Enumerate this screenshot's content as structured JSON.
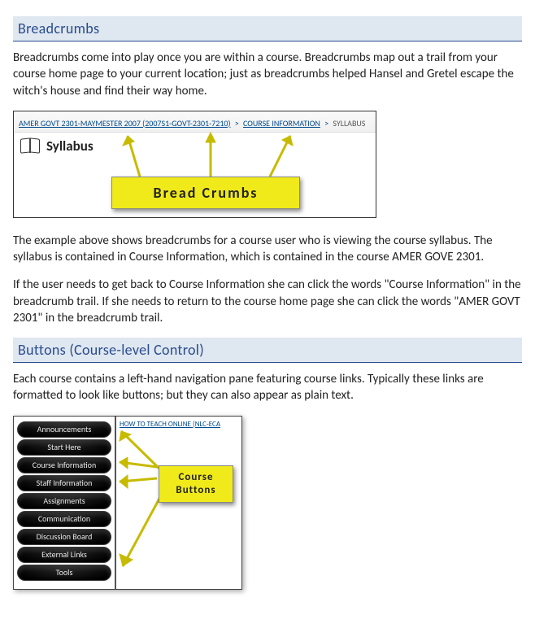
{
  "sections": {
    "breadcrumbs": {
      "heading": "Breadcrumbs",
      "intro": "Breadcrumbs come into play once you are within a course.  Breadcrumbs map out a trail from your course home page to your current location; just as breadcrumbs helped Hansel and Gretel escape the witch's house and find their way home.",
      "para2": "The example above shows breadcrumbs for a course user who is viewing the course syllabus. The syllabus is contained in Course Information, which is contained in the course AMER GOVE 2301.",
      "para3": "If the user needs to get back to Course Information she can click the words \"Course Information\" in the breadcrumb trail.  If she needs to return to the course home page she can click the words \"AMER GOVT 2301\" in the breadcrumb trail."
    },
    "buttons": {
      "heading": "Buttons (Course-level Control)",
      "intro": "Each course contains a left-hand navigation pane featuring course links.  Typically these links are formatted to look like buttons; but they can also appear as plain text."
    }
  },
  "fig1": {
    "bc1": "AMER GOVT 2301-MAYMESTER 2007 (2007S1-GOVT-2301-7210)",
    "bc2": "COURSE INFORMATION",
    "bc3": "SYLLABUS",
    "sep": ">",
    "title": "Syllabus",
    "callout": "Bread Crumbs"
  },
  "fig2": {
    "topLink": "HOW TO TEACH ONLINE (NLC-ECA",
    "buttons": {
      "b0": "Announcements",
      "b1": "Start Here",
      "b2": "Course Information",
      "b3": "Staff Information",
      "b4": "Assignments",
      "b5": "Communication",
      "b6": "Discussion Board",
      "b7": "External Links",
      "b8": "Tools"
    },
    "callout_l1": "Course",
    "callout_l2": "Buttons"
  }
}
